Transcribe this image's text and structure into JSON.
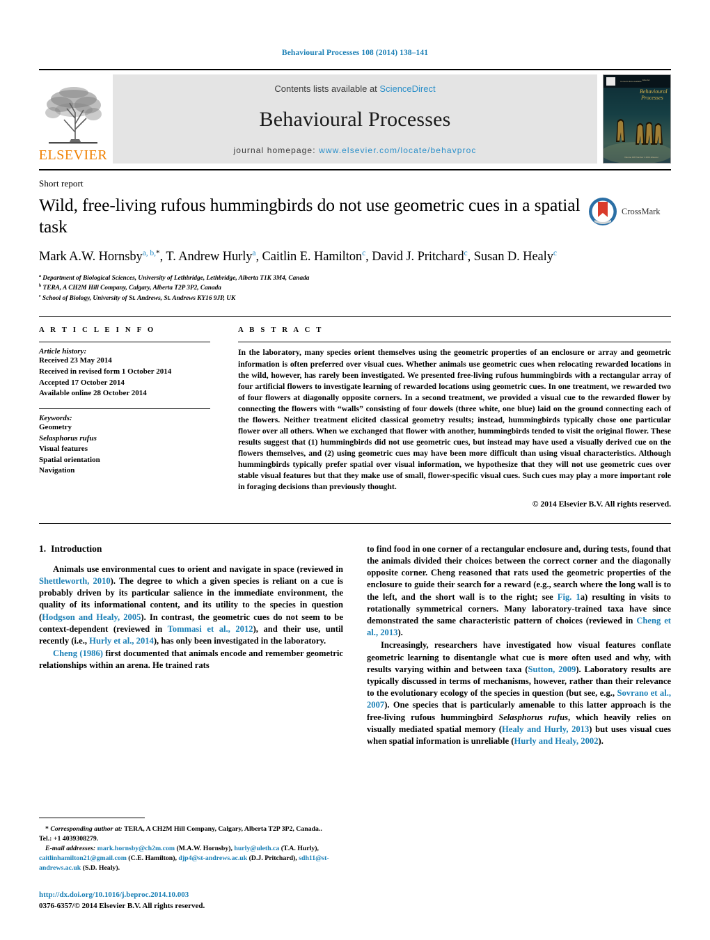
{
  "running_head": "Behavioural Processes 108 (2014) 138–141",
  "masthead": {
    "publisher_name": "ELSEVIER",
    "contents_prefix": "Contents lists available at ",
    "contents_link": "ScienceDirect",
    "journal_title": "Behavioural Processes",
    "homepage_prefix": "journal homepage: ",
    "homepage_url": "www.elsevier.com/locate/behavproc",
    "cover_journal_line1": "Behavioural",
    "cover_journal_line2": "Processes",
    "link_color": "#2b8fc9",
    "elsevier_orange": "#F08000"
  },
  "article": {
    "type_label": "Short report",
    "title": "Wild, free-living rufous hummingbirds do not use geometric cues in a spatial task",
    "crossmark_label": "CrossMark",
    "authors_html": "Mark A.W. Hornsby<sup>a, b,</sup><sup class=\"star\">*</sup>, T. Andrew Hurly<sup>a</sup>, Caitlin E. Hamilton<sup>c</sup>, David J. Pritchard<sup>c</sup>, Susan D. Healy<sup>c</sup>",
    "affiliations": [
      {
        "marker": "a",
        "text": "Department of Biological Sciences, University of Lethbridge, Lethbridge, Alberta T1K 3M4, Canada"
      },
      {
        "marker": "b",
        "text": "TERA, A CH2M Hill Company, Calgary, Alberta T2P 3P2, Canada"
      },
      {
        "marker": "c",
        "text": "School of Biology, University of St. Andrews, St. Andrews KY16 9JP, UK"
      }
    ]
  },
  "article_info": {
    "heading": "A R T I C L E   I N F O",
    "history_label": "Article history:",
    "history": [
      "Received 23 May 2014",
      "Received in revised form 1 October 2014",
      "Accepted 17 October 2014",
      "Available online 28 October 2014"
    ],
    "keywords_label": "Keywords:",
    "keywords": [
      "Geometry",
      "Selasphorus rufus",
      "Visual features",
      "Spatial orientation",
      "Navigation"
    ],
    "keywords_italic_index": 1
  },
  "abstract": {
    "heading": "A B S T R A C T",
    "text": "In the laboratory, many species orient themselves using the geometric properties of an enclosure or array and geometric information is often preferred over visual cues. Whether animals use geometric cues when relocating rewarded locations in the wild, however, has rarely been investigated. We presented free-living rufous hummingbirds with a rectangular array of four artificial flowers to investigate learning of rewarded locations using geometric cues. In one treatment, we rewarded two of four flowers at diagonally opposite corners. In a second treatment, we provided a visual cue to the rewarded flower by connecting the flowers with “walls” consisting of four dowels (three white, one blue) laid on the ground connecting each of the flowers. Neither treatment elicited classical geometry results; instead, hummingbirds typically chose one particular flower over all others. When we exchanged that flower with another, hummingbirds tended to visit the original flower. These results suggest that (1) hummingbirds did not use geometric cues, but instead may have used a visually derived cue on the flowers themselves, and (2) using geometric cues may have been more difficult than using visual characteristics. Although hummingbirds typically prefer spatial over visual information, we hypothesize that they will not use geometric cues over stable visual features but that they make use of small, flower-specific visual cues. Such cues may play a more important role in foraging decisions than previously thought.",
    "copyright": "© 2014 Elsevier B.V. All rights reserved."
  },
  "body": {
    "section_number": "1.",
    "section_title": "Introduction",
    "left_paragraphs": [
      "Animals use environmental cues to orient and navigate in space (reviewed in <span class=\"ref\">Shettleworth, 2010</span>). The degree to which a given species is reliant on a cue is probably driven by its particular salience in the immediate environment, the quality of its informational content, and its utility to the species in question (<span class=\"ref\">Hodgson and Healy, 2005</span>). In contrast, the geometric cues do not seem to be context-dependent (reviewed in <span class=\"ref\">Tommasi et al., 2012</span>), and their use, until recently (i.e., <span class=\"ref\">Hurly et al., 2014</span>), has only been investigated in the laboratory.",
      "<span class=\"ref\">Cheng (1986)</span> first documented that animals encode and remember geometric relationships within an arena. He trained rats"
    ],
    "right_paragraphs": [
      "to find food in one corner of a rectangular enclosure and, during tests, found that the animals divided their choices between the correct corner and the diagonally opposite corner. Cheng reasoned that rats used the geometric properties of the enclosure to guide their search for a reward (e.g., search where the long wall is to the left, and the short wall is to the right; see <span class=\"ref\">Fig. 1</span>a) resulting in visits to rotationally symmetrical corners. Many laboratory-trained taxa have since demonstrated the same characteristic pattern of choices (reviewed in <span class=\"ref\">Cheng et al., 2013</span>).",
      "Increasingly, researchers have investigated how visual features conflate geometric learning to disentangle what cue is more often used and why, with results varying within and between taxa (<span class=\"ref\">Sutton, 2009</span>). Laboratory results are typically discussed in terms of mechanisms, however, rather than their relevance to the evolutionary ecology of the species in question (but see, e.g., <span class=\"ref\">Sovrano et al., 2007</span>). One species that is particularly amenable to this latter approach is the free-living rufous hummingbird <span class=\"ital\">Selasphorus rufus</span>, which heavily relies on visually mediated spatial memory (<span class=\"ref\">Healy and Hurly, 2013</span>) but uses visual cues when spatial information is unreliable (<span class=\"ref\">Hurly and Healy, 2002</span>)."
    ]
  },
  "footnotes": {
    "corresponding_html": "<span class=\"lead\">* <span class=\"fn-em\">Corresponding author at:</span> TERA, A CH2M Hill Company, Calgary, Alberta T2P 3P2, Canada.. Tel.: +1 4039308279.</span>",
    "emails_html": "<span class=\"lead\"><span class=\"fn-em\">E-mail addresses:</span> <span class=\"ref\">mark.hornsby@ch2m.com</span> (M.A.W. Hornsby), <span class=\"ref\">hurly@uleth.ca</span> (T.A. Hurly), <span class=\"ref\">caitlinhamilton21@gmail.com</span> (C.E. Hamilton), <span class=\"ref\">djp4@st-andrews.ac.uk</span> (D.J. Pritchard), <span class=\"ref\">sdh11@st-andrews.ac.uk</span> (S.D. Healy).</span>",
    "doi_url": "http://dx.doi.org/10.1016/j.beproc.2014.10.003",
    "issn_line": "0376-6357/© 2014 Elsevier B.V. All rights reserved."
  }
}
